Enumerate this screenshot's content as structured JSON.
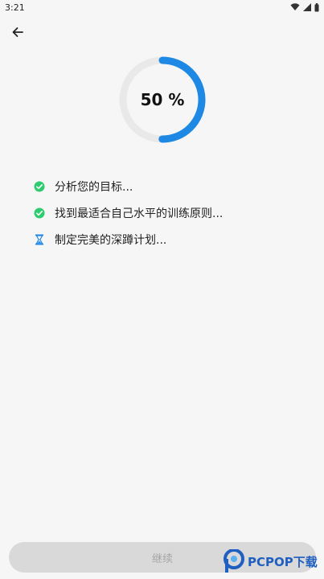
{
  "status_bar": {
    "time": "3:21"
  },
  "progress": {
    "percent": 50,
    "label": "50 %"
  },
  "steps": [
    {
      "text": "分析您的目标...",
      "state": "done",
      "icon": "check-circle-icon"
    },
    {
      "text": "找到最适合自己水平的训练原则...",
      "state": "done",
      "icon": "check-circle-icon"
    },
    {
      "text": "制定完美的深蹲计划...",
      "state": "in-progress",
      "icon": "hourglass-icon"
    }
  ],
  "continue_button": {
    "label": "继续"
  },
  "watermark": {
    "brand": "PCPOP下载"
  },
  "colors": {
    "accent": "#1e88e5",
    "track": "#e9e9e9",
    "success": "#2ecc71",
    "button_disabled_bg": "#d9d9d9",
    "button_disabled_text": "#a6a6a6"
  }
}
